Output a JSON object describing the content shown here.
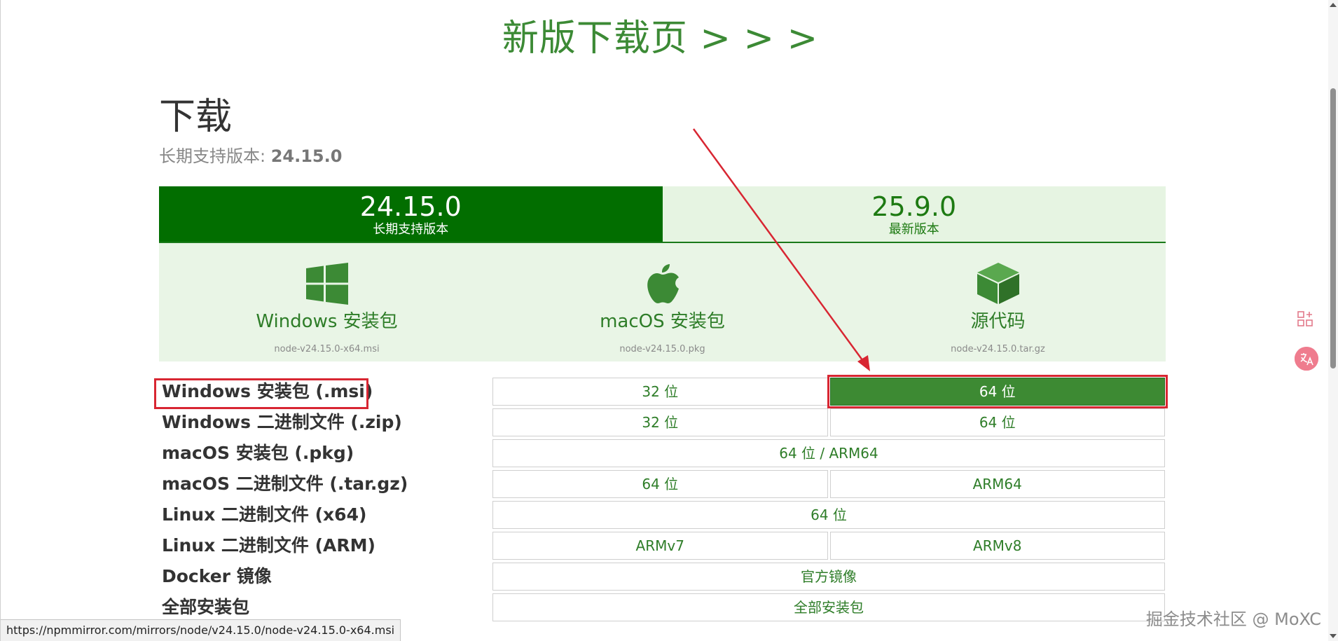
{
  "top_link": "新版下载页 > > >",
  "heading": {
    "title": "下载",
    "subtitle_prefix": "长期支持版本: ",
    "subtitle_version": "24.15.0"
  },
  "tabs": [
    {
      "version": "24.15.0",
      "label": "长期支持版本",
      "active": true
    },
    {
      "version": "25.9.0",
      "label": "最新版本",
      "active": false
    }
  ],
  "downloads": [
    {
      "icon": "windows-icon",
      "name": "Windows 安装包",
      "file": "node-v24.15.0-x64.msi"
    },
    {
      "icon": "apple-icon",
      "name": "macOS 安装包",
      "file": "node-v24.15.0.pkg"
    },
    {
      "icon": "cube-icon",
      "name": "源代码",
      "file": "node-v24.15.0.tar.gz"
    }
  ],
  "table": [
    {
      "label": "Windows 安装包 (.msi)",
      "cells": [
        "32 位",
        "64 位"
      ]
    },
    {
      "label": "Windows 二进制文件 (.zip)",
      "cells": [
        "32 位",
        "64 位"
      ]
    },
    {
      "label": "macOS 安装包 (.pkg)",
      "cells": [
        "64 位 / ARM64"
      ]
    },
    {
      "label": "macOS 二进制文件 (.tar.gz)",
      "cells": [
        "64 位",
        "ARM64"
      ]
    },
    {
      "label": "Linux 二进制文件 (x64)",
      "cells": [
        "64 位"
      ]
    },
    {
      "label": "Linux 二进制文件 (ARM)",
      "cells": [
        "ARMv7",
        "ARMv8"
      ]
    },
    {
      "label": "Docker 镜像",
      "cells": [
        "官方镜像"
      ]
    },
    {
      "label": "全部安装包",
      "cells": [
        "全部安装包"
      ]
    }
  ],
  "status_url": "https://npmmirror.com/mirrors/node/v24.15.0/node-v24.15.0-x64.msi",
  "watermark": "掘金技术社区 @ MoXC",
  "colors": {
    "brand_green": "#026e00",
    "link_green": "#2e7d28",
    "highlight_red": "#d82632",
    "panel_bg": "#e9f5e6"
  }
}
